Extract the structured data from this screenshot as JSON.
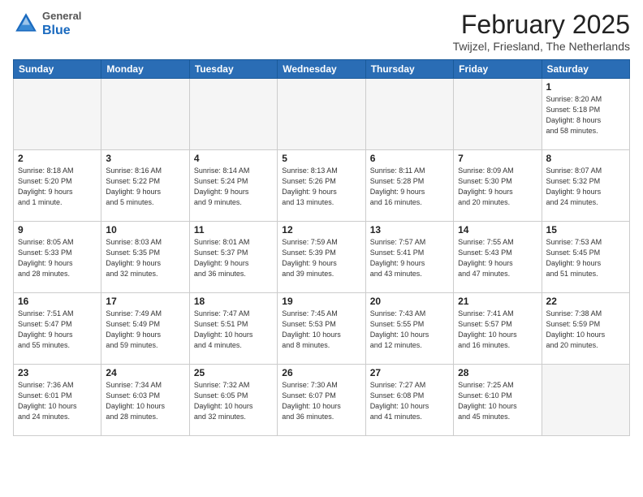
{
  "header": {
    "logo_general": "General",
    "logo_blue": "Blue",
    "month_title": "February 2025",
    "location": "Twijzel, Friesland, The Netherlands"
  },
  "weekdays": [
    "Sunday",
    "Monday",
    "Tuesday",
    "Wednesday",
    "Thursday",
    "Friday",
    "Saturday"
  ],
  "weeks": [
    [
      {
        "day": "",
        "info": ""
      },
      {
        "day": "",
        "info": ""
      },
      {
        "day": "",
        "info": ""
      },
      {
        "day": "",
        "info": ""
      },
      {
        "day": "",
        "info": ""
      },
      {
        "day": "",
        "info": ""
      },
      {
        "day": "1",
        "info": "Sunrise: 8:20 AM\nSunset: 5:18 PM\nDaylight: 8 hours\nand 58 minutes."
      }
    ],
    [
      {
        "day": "2",
        "info": "Sunrise: 8:18 AM\nSunset: 5:20 PM\nDaylight: 9 hours\nand 1 minute."
      },
      {
        "day": "3",
        "info": "Sunrise: 8:16 AM\nSunset: 5:22 PM\nDaylight: 9 hours\nand 5 minutes."
      },
      {
        "day": "4",
        "info": "Sunrise: 8:14 AM\nSunset: 5:24 PM\nDaylight: 9 hours\nand 9 minutes."
      },
      {
        "day": "5",
        "info": "Sunrise: 8:13 AM\nSunset: 5:26 PM\nDaylight: 9 hours\nand 13 minutes."
      },
      {
        "day": "6",
        "info": "Sunrise: 8:11 AM\nSunset: 5:28 PM\nDaylight: 9 hours\nand 16 minutes."
      },
      {
        "day": "7",
        "info": "Sunrise: 8:09 AM\nSunset: 5:30 PM\nDaylight: 9 hours\nand 20 minutes."
      },
      {
        "day": "8",
        "info": "Sunrise: 8:07 AM\nSunset: 5:32 PM\nDaylight: 9 hours\nand 24 minutes."
      }
    ],
    [
      {
        "day": "9",
        "info": "Sunrise: 8:05 AM\nSunset: 5:33 PM\nDaylight: 9 hours\nand 28 minutes."
      },
      {
        "day": "10",
        "info": "Sunrise: 8:03 AM\nSunset: 5:35 PM\nDaylight: 9 hours\nand 32 minutes."
      },
      {
        "day": "11",
        "info": "Sunrise: 8:01 AM\nSunset: 5:37 PM\nDaylight: 9 hours\nand 36 minutes."
      },
      {
        "day": "12",
        "info": "Sunrise: 7:59 AM\nSunset: 5:39 PM\nDaylight: 9 hours\nand 39 minutes."
      },
      {
        "day": "13",
        "info": "Sunrise: 7:57 AM\nSunset: 5:41 PM\nDaylight: 9 hours\nand 43 minutes."
      },
      {
        "day": "14",
        "info": "Sunrise: 7:55 AM\nSunset: 5:43 PM\nDaylight: 9 hours\nand 47 minutes."
      },
      {
        "day": "15",
        "info": "Sunrise: 7:53 AM\nSunset: 5:45 PM\nDaylight: 9 hours\nand 51 minutes."
      }
    ],
    [
      {
        "day": "16",
        "info": "Sunrise: 7:51 AM\nSunset: 5:47 PM\nDaylight: 9 hours\nand 55 minutes."
      },
      {
        "day": "17",
        "info": "Sunrise: 7:49 AM\nSunset: 5:49 PM\nDaylight: 9 hours\nand 59 minutes."
      },
      {
        "day": "18",
        "info": "Sunrise: 7:47 AM\nSunset: 5:51 PM\nDaylight: 10 hours\nand 4 minutes."
      },
      {
        "day": "19",
        "info": "Sunrise: 7:45 AM\nSunset: 5:53 PM\nDaylight: 10 hours\nand 8 minutes."
      },
      {
        "day": "20",
        "info": "Sunrise: 7:43 AM\nSunset: 5:55 PM\nDaylight: 10 hours\nand 12 minutes."
      },
      {
        "day": "21",
        "info": "Sunrise: 7:41 AM\nSunset: 5:57 PM\nDaylight: 10 hours\nand 16 minutes."
      },
      {
        "day": "22",
        "info": "Sunrise: 7:38 AM\nSunset: 5:59 PM\nDaylight: 10 hours\nand 20 minutes."
      }
    ],
    [
      {
        "day": "23",
        "info": "Sunrise: 7:36 AM\nSunset: 6:01 PM\nDaylight: 10 hours\nand 24 minutes."
      },
      {
        "day": "24",
        "info": "Sunrise: 7:34 AM\nSunset: 6:03 PM\nDaylight: 10 hours\nand 28 minutes."
      },
      {
        "day": "25",
        "info": "Sunrise: 7:32 AM\nSunset: 6:05 PM\nDaylight: 10 hours\nand 32 minutes."
      },
      {
        "day": "26",
        "info": "Sunrise: 7:30 AM\nSunset: 6:07 PM\nDaylight: 10 hours\nand 36 minutes."
      },
      {
        "day": "27",
        "info": "Sunrise: 7:27 AM\nSunset: 6:08 PM\nDaylight: 10 hours\nand 41 minutes."
      },
      {
        "day": "28",
        "info": "Sunrise: 7:25 AM\nSunset: 6:10 PM\nDaylight: 10 hours\nand 45 minutes."
      },
      {
        "day": "",
        "info": ""
      }
    ]
  ]
}
